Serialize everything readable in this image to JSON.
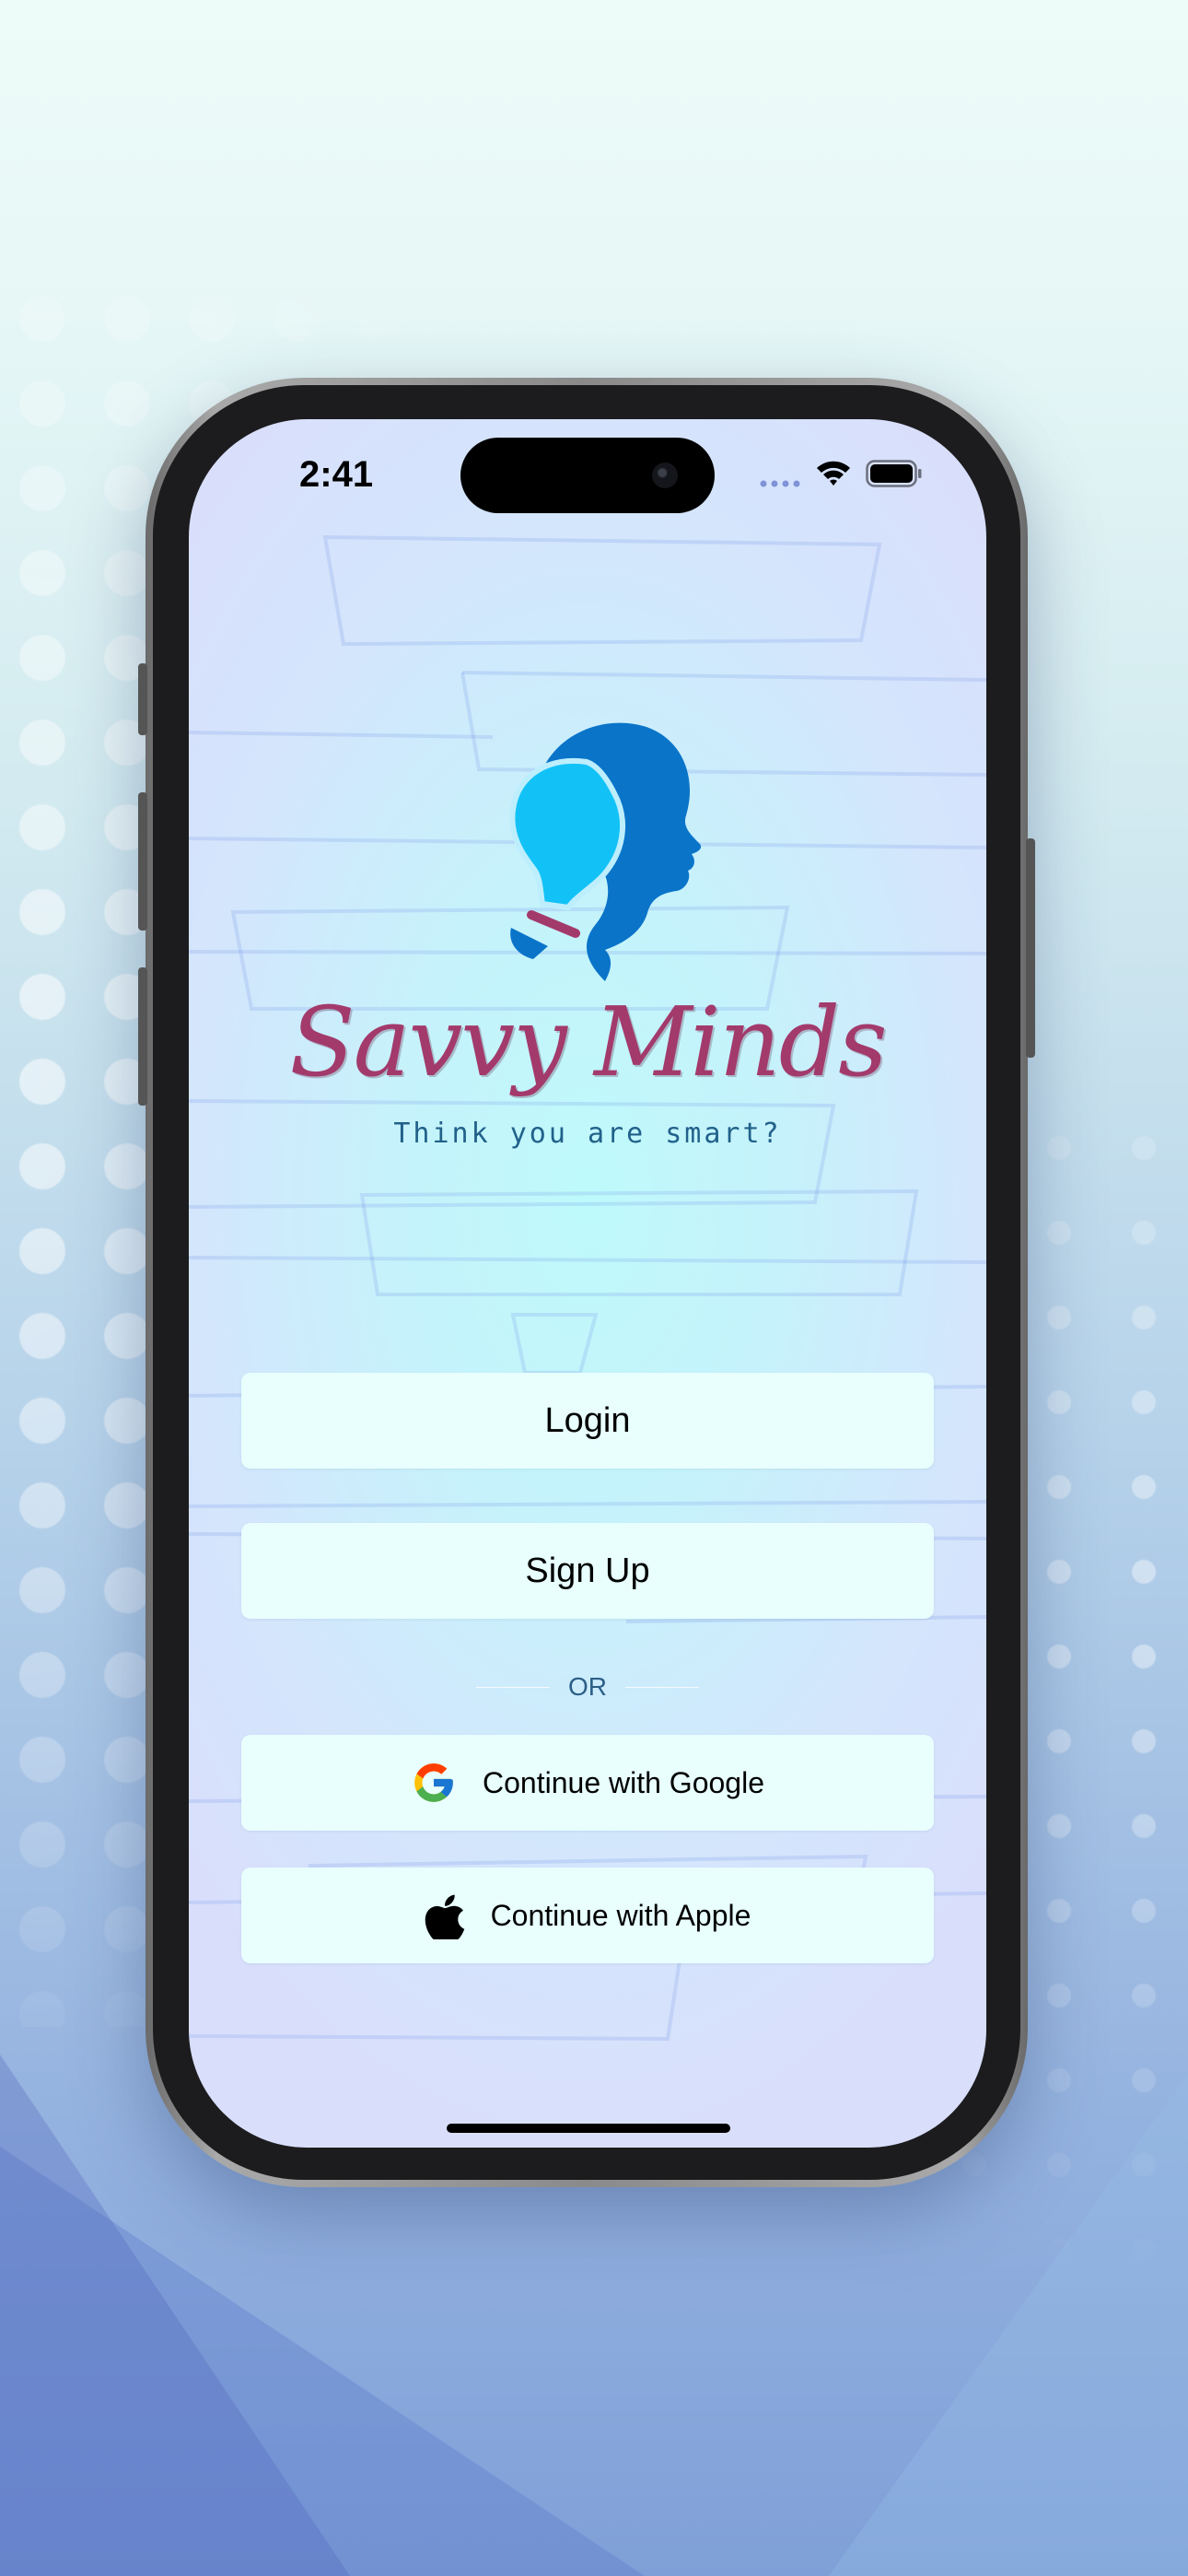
{
  "status_bar": {
    "time": "2:41"
  },
  "brand": {
    "name": "Savvy Minds",
    "tagline": "Think you are smart?"
  },
  "auth": {
    "login_label": "Login",
    "signup_label": "Sign Up",
    "divider_label": "OR",
    "google_label": "Continue with Google",
    "apple_label": "Continue with Apple"
  },
  "colors": {
    "brand_wordmark": "#a33a6c",
    "tagline": "#21618a",
    "button_bg": "#e8fffe",
    "logo_blue": "#0a74c9",
    "logo_cyan": "#12c2f7"
  },
  "icons": [
    "camera-icon",
    "signal-icon",
    "wifi-icon",
    "battery-icon",
    "google-icon",
    "apple-icon"
  ]
}
